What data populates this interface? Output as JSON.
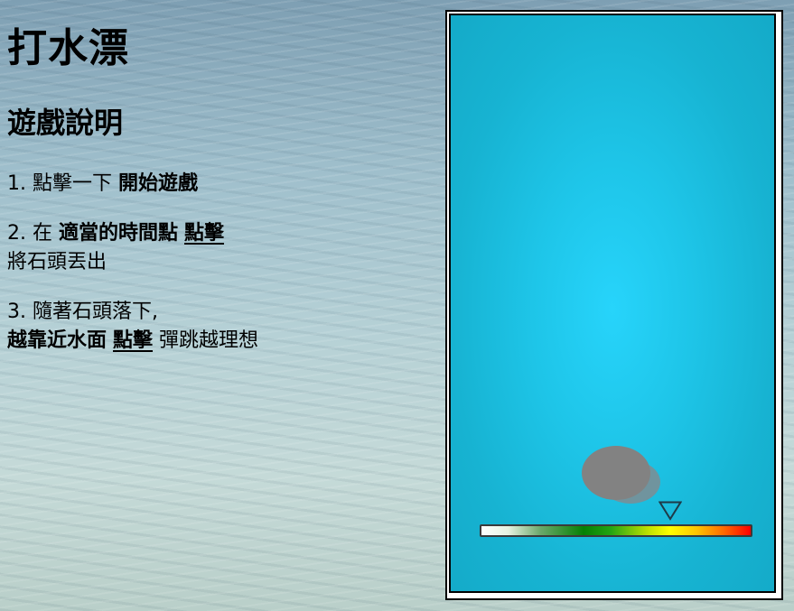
{
  "title": "打水漂",
  "instructions": {
    "heading": "遊戲說明",
    "step1": {
      "prefix": "1. 點擊一下 ",
      "bold": "開始遊戲"
    },
    "step2": {
      "prefix": "2. 在 ",
      "bold": "適當的時間點",
      "underline": "點擊",
      "line2": "將石頭丟出"
    },
    "step3": {
      "line1": "3. 隨著石頭落下,",
      "bold": "越靠近水面",
      "underline": "點擊",
      "suffix": " 彈跳越理想"
    }
  },
  "game": {
    "stone_icon": "stone-icon",
    "marker_icon": "down-triangle-icon",
    "power_level": 0.7,
    "colors": {
      "water": "#1ec5e8",
      "stone": "#828282",
      "bar_start": "#ffffff",
      "bar_mid": "#058005",
      "bar_yellow": "#ffff00",
      "bar_end": "#ff0000"
    }
  }
}
